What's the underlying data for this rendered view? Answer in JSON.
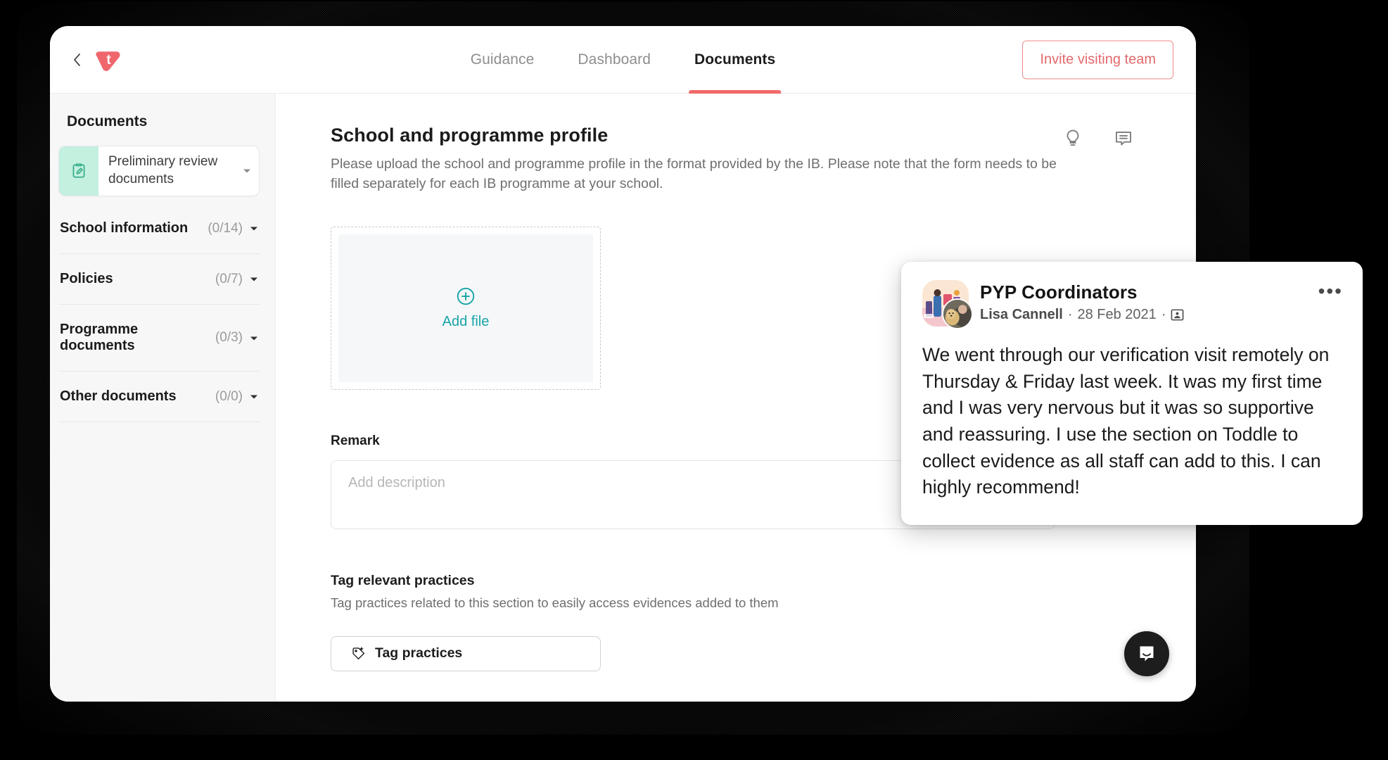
{
  "app": {
    "brand_letter": "t",
    "back_icon": "chevron-left-icon"
  },
  "header": {
    "tabs": [
      {
        "label": "Guidance",
        "active": false
      },
      {
        "label": "Dashboard",
        "active": false
      },
      {
        "label": "Documents",
        "active": true
      }
    ],
    "invite_button": "Invite visiting team",
    "accent_color": "#f06a6a"
  },
  "sidebar": {
    "title": "Documents",
    "active_card": {
      "label": "Preliminary review documents",
      "icon": "document-edit-icon",
      "icon_bg": "#c3f0df",
      "caret": "chevron-down-icon"
    },
    "items": [
      {
        "label": "School information",
        "count": "(0/14)"
      },
      {
        "label": "Policies",
        "count": "(0/7)"
      },
      {
        "label": "Programme documents",
        "count": "(0/3)"
      },
      {
        "label": "Other documents",
        "count": "(0/0)"
      }
    ]
  },
  "main": {
    "title": "School and programme profile",
    "description": "Please upload the school and programme profile in the format provided by the IB. Please note that the form needs to be filled separately for each IB programme at your school.",
    "header_icons": [
      {
        "name": "lightbulb-icon"
      },
      {
        "name": "comment-icon"
      }
    ],
    "dropzone": {
      "label": "Add file",
      "icon": "plus-circle-icon",
      "accent_color": "#17a3a8"
    },
    "remark": {
      "label": "Remark",
      "placeholder": "Add description",
      "value": ""
    },
    "tag_section": {
      "title": "Tag relevant practices",
      "subtitle": "Tag practices related to this section to easily access evidences added to them",
      "button_label": "Tag practices",
      "button_icon": "tag-plus-icon"
    }
  },
  "testimonial": {
    "group": "PYP Coordinators",
    "author": "Lisa Cannell",
    "separator": "·",
    "date": "28 Feb 2021",
    "audience_icon": "group-audience-icon",
    "more_icon": "•••",
    "body": "We went through our verification visit remotely on Thursday & Friday last week. It was my first time and I was very nervous but it was so supportive and reassuring. I use the section on Toddle to collect evidence as all staff can add to this. I can highly recommend!"
  },
  "chat_launcher": {
    "icon": "intercom-chat-icon",
    "bg_color": "#1d1d1d"
  }
}
